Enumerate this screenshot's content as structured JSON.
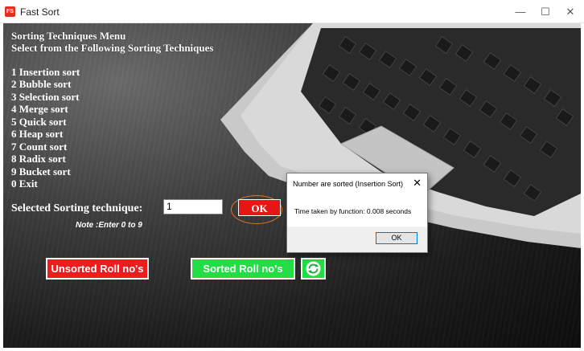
{
  "window": {
    "title": "Fast Sort",
    "app_icon_text": "FS",
    "minimize_symbol": "—",
    "maximize_symbol": "☐",
    "close_symbol": "✕"
  },
  "menu": {
    "heading": "Sorting Techniques Menu",
    "subheading": "Select from the Following Sorting Techniques",
    "items": [
      "1 Insertion sort",
      "2 Bubble sort",
      "3 Selection sort",
      "4 Merge sort",
      "5 Quick sort",
      "6 Heap sort",
      "7 Count sort",
      "8 Radix sort",
      "9  Bucket sort",
      "0  Exit"
    ]
  },
  "selection": {
    "label": "Selected Sorting technique:",
    "value": "1",
    "ok_label": "OK",
    "note": "Note :Enter 0 to 9"
  },
  "buttons": {
    "unsorted_label": "Unsorted Roll no's",
    "sorted_label": "Sorted Roll no's",
    "refresh_icon": "refresh-icon"
  },
  "dialog": {
    "title": "Number are sorted (Insertion Sort)",
    "message": "Time taken by function: 0.008 seconds",
    "ok_label": "OK",
    "close_symbol": "✕"
  },
  "colors": {
    "ok_button": "#e41616",
    "unsorted_button": "#ee1c1c",
    "sorted_button": "#22dd44",
    "highlight_ring": "#e07a1e"
  }
}
